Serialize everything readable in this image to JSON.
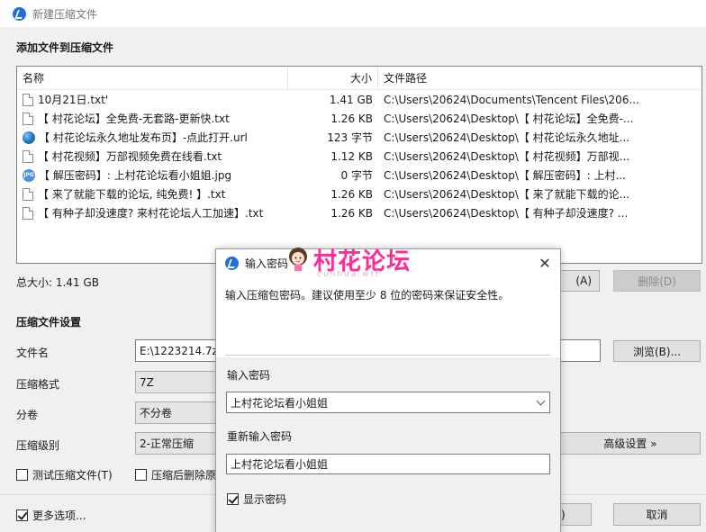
{
  "window": {
    "title": "新建压缩文件"
  },
  "sections": {
    "add_files": "添加文件到压缩文件",
    "settings": "压缩文件设置"
  },
  "file_list": {
    "columns": {
      "name": "名称",
      "size": "大小",
      "path": "文件路径"
    },
    "rows": [
      {
        "icon": "file-icon",
        "name": "10月21日.txt'",
        "size": "1.41 GB",
        "path": "C:\\Users\\20624\\Documents\\Tencent Files\\206..."
      },
      {
        "icon": "file-icon",
        "name": "【 村花论坛】全免费-无套路-更新快.txt",
        "size": "1.26 KB",
        "path": "C:\\Users\\20624\\Desktop\\【 村花论坛】全免费-..."
      },
      {
        "icon": "globe-icon",
        "name": "【 村花论坛永久地址发布页】-点此打开.url",
        "size": "123 字节",
        "path": "C:\\Users\\20624\\Desktop\\【 村花论坛永久地址..."
      },
      {
        "icon": "file-icon",
        "name": "【 村花视频】万部视频免费在线看.txt",
        "size": "1.12 KB",
        "path": "C:\\Users\\20624\\Desktop\\【 村花视频】万部视..."
      },
      {
        "icon": "jpg-icon",
        "name": "【 解压密码】: 上村花论坛看小姐姐.jpg",
        "size": "0 字节",
        "path": "C:\\Users\\20624\\Desktop\\【 解压密码】: 上村..."
      },
      {
        "icon": "file-icon",
        "name": "【 来了就能下载的论坛, 纯免费! 】.txt",
        "size": "1.26 KB",
        "path": "C:\\Users\\20624\\Desktop\\【 来了就能下载的论..."
      },
      {
        "icon": "file-icon",
        "name": "【 有种子却没速度? 来村花论坛人工加速】.txt",
        "size": "1.26 KB",
        "path": "C:\\Users\\20624\\Desktop\\【 有种子却没速度? ..."
      }
    ]
  },
  "total": {
    "label": "总大小: 1.41 GB"
  },
  "buttons": {
    "add_partial": "(A)",
    "delete": "删除(D)",
    "browse": "浏览(B)...",
    "advanced": "高级设置 »",
    "ok_partial": ")",
    "cancel": "取消"
  },
  "settings": {
    "filename_label": "文件名",
    "filename_value": "E:\\1223214.7z",
    "format_label": "压缩格式",
    "format_value": "7Z",
    "split_label": "分卷",
    "split_value": "不分卷",
    "level_label": "压缩级别",
    "level_value": "2-正常压缩",
    "test_label": "测试压缩文件(T)",
    "delete_after_label": "压缩后删除原",
    "more_label": "更多选项..."
  },
  "dialog": {
    "title": "输入密码",
    "hint": "输入压缩包密码。建议使用至少 8 位的密码来保证安全性。",
    "pw_label": "输入密码",
    "pw_value": "上村花论坛看小姐姐",
    "repw_label": "重新输入密码",
    "repw_value": "上村花论坛看小姐姐",
    "show_label": "显示密码",
    "show_checked": true
  },
  "watermark": {
    "text": "村花论坛",
    "url": "cunhua.wtf"
  }
}
